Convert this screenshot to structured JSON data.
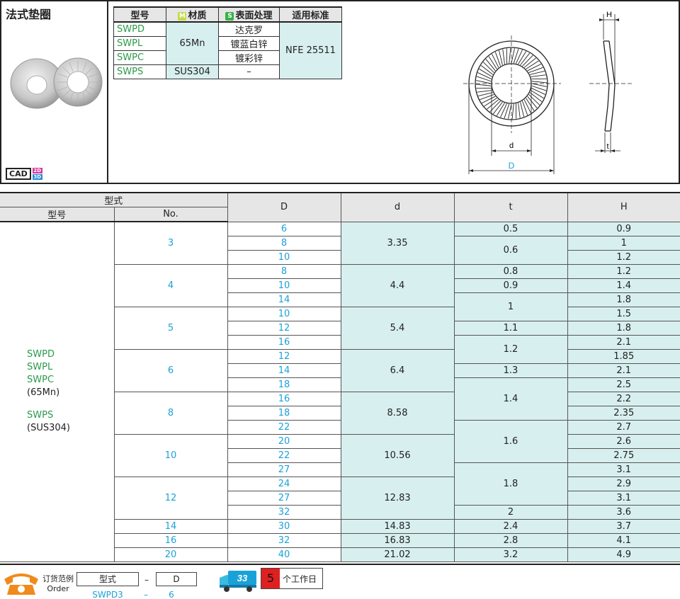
{
  "product": {
    "title": "法式垫圈",
    "cad": "CAD",
    "cad_2d": "2D",
    "cad_3d": "3D"
  },
  "spec_table": {
    "headers": {
      "model": "型号",
      "material_mark": "M",
      "material": "材质",
      "surface_mark": "S",
      "surface": "表面处理",
      "standard": "适用标准"
    },
    "rows": [
      {
        "code": "SWPD",
        "surface": "达克罗"
      },
      {
        "code": "SWPL",
        "surface": "镀蓝白锌"
      },
      {
        "code": "SWPC",
        "surface": "镀彩锌"
      },
      {
        "code": "SWPS",
        "material": "SUS304",
        "surface": "–"
      }
    ],
    "material_65": "65Mn",
    "standard": "NFE 25511"
  },
  "drawing": {
    "H": "H",
    "t": "t",
    "d": "d",
    "D": "D"
  },
  "main_table": {
    "headers": {
      "type": "型式",
      "model": "型号",
      "no": "No.",
      "D": "D",
      "d": "d",
      "t": "t",
      "H": "H"
    },
    "models": {
      "a1": "SWPD",
      "a2": "SWPL",
      "a3": "SWPC",
      "a4": "(65Mn)",
      "b1": "SWPS",
      "b2": "(SUS304)"
    },
    "groups": [
      {
        "no": "3",
        "d": "3.35",
        "rows": [
          {
            "D": "6",
            "t": "0.5",
            "H": "0.9"
          },
          {
            "D": "8",
            "t": "0.6",
            "H": "1"
          },
          {
            "D": "10",
            "H": "1.2"
          }
        ]
      },
      {
        "no": "4",
        "d": "4.4",
        "rows": [
          {
            "D": "8",
            "t": "0.8",
            "H": "1.2"
          },
          {
            "D": "10",
            "t": "0.9",
            "H": "1.4"
          },
          {
            "D": "14",
            "t": "1",
            "H": "1.8"
          }
        ]
      },
      {
        "no": "5",
        "d": "5.4",
        "rows": [
          {
            "D": "10",
            "H": "1.5"
          },
          {
            "D": "12",
            "t": "1.1",
            "H": "1.8"
          },
          {
            "D": "16",
            "t": "1.2",
            "H": "2.1"
          }
        ]
      },
      {
        "no": "6",
        "d": "6.4",
        "rows": [
          {
            "D": "12",
            "H": "1.85"
          },
          {
            "D": "14",
            "t": "1.3",
            "H": "2.1"
          },
          {
            "D": "18",
            "t": "1.4",
            "H": "2.5"
          }
        ]
      },
      {
        "no": "8",
        "d": "8.58",
        "rows": [
          {
            "D": "16",
            "H": "2.2"
          },
          {
            "D": "18",
            "H": "2.35"
          },
          {
            "D": "22",
            "t": "1.6",
            "H": "2.7"
          }
        ]
      },
      {
        "no": "10",
        "d": "10.56",
        "rows": [
          {
            "D": "20",
            "H": "2.6"
          },
          {
            "D": "22",
            "H": "2.75"
          },
          {
            "D": "27",
            "t": "1.8",
            "H": "3.1"
          }
        ]
      },
      {
        "no": "12",
        "d": "12.83",
        "rows": [
          {
            "D": "24",
            "H": "2.9"
          },
          {
            "D": "27",
            "H": "3.1"
          },
          {
            "D": "32",
            "t": "2",
            "H": "3.6"
          }
        ]
      },
      {
        "no": "14",
        "d": "14.83",
        "rows": [
          {
            "D": "30",
            "t": "2.4",
            "H": "3.7"
          }
        ]
      },
      {
        "no": "16",
        "d": "16.83",
        "rows": [
          {
            "D": "32",
            "t": "2.8",
            "H": "4.1"
          }
        ]
      },
      {
        "no": "20",
        "d": "21.02",
        "rows": [
          {
            "D": "40",
            "t": "3.2",
            "H": "4.9"
          }
        ]
      }
    ]
  },
  "order": {
    "label_cn": "订货范例",
    "label_en": "Order",
    "type_label": "型式",
    "dash": "–",
    "D_label": "D",
    "type_value": "SWPD3",
    "D_value": "6",
    "truck_text": "33",
    "days": "5",
    "days_text": "个工作日"
  }
}
